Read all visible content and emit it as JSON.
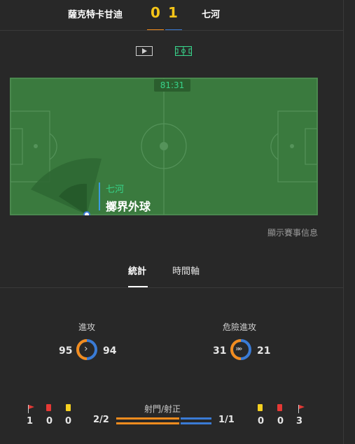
{
  "header": {
    "home_team": "薩克特卡甘迪",
    "home_score": "0",
    "away_score": "1",
    "away_team": "七河",
    "home_color": "#f28c1e",
    "away_color": "#3a7bd5"
  },
  "controls": {
    "video_icon": "play-icon",
    "field_icon": "pitch-icon"
  },
  "field": {
    "clock": "81:31",
    "event_team": "七河",
    "event_name": "擲界外球"
  },
  "info_link": "顯示賽事信息",
  "tabs": [
    {
      "label": "統計",
      "active": true
    },
    {
      "label": "時間軸",
      "active": false
    }
  ],
  "stats": {
    "attack": {
      "label": "進攻",
      "home": "95",
      "away": "94"
    },
    "dangerous_attack": {
      "label": "危險進攻",
      "home": "31",
      "away": "21"
    },
    "shots": {
      "label": "射門/射正",
      "home": "2/2",
      "away": "1/1"
    }
  },
  "home_cards": {
    "corners": "1",
    "red": "0",
    "yellow": "0"
  },
  "away_cards": {
    "yellow": "0",
    "red": "0",
    "corners": "3"
  },
  "colors": {
    "accent_home": "#f28c1e",
    "accent_away": "#3a7bd5",
    "pitch": "#3a7a3e",
    "yellow_card": "#f5d020",
    "red_card": "#e53935"
  }
}
